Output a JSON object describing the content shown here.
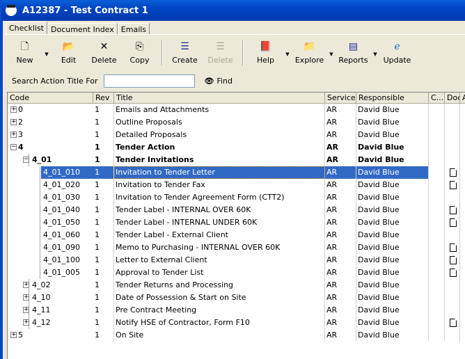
{
  "window": {
    "title": "A12387 - Test Contract 1"
  },
  "tabs": [
    {
      "label": "Checklist",
      "active": true
    },
    {
      "label": "Document Index"
    },
    {
      "label": "Emails"
    }
  ],
  "toolbar": [
    {
      "label": "New",
      "icon": "new-document-icon",
      "dropdown": true
    },
    {
      "label": "Edit",
      "icon": "open-folder-icon"
    },
    {
      "label": "Delete",
      "icon": "delete-x-icon"
    },
    {
      "label": "Copy",
      "icon": "copy-icon"
    },
    {
      "sep": true
    },
    {
      "label": "Create",
      "icon": "create-document-icon"
    },
    {
      "label": "Delete",
      "icon": "delete-document-icon",
      "disabled": true
    },
    {
      "sep": true
    },
    {
      "label": "Help",
      "icon": "help-book-icon",
      "dropdown": true
    },
    {
      "label": "Explore",
      "icon": "explore-folder-icon",
      "dropdown": true
    },
    {
      "label": "Reports",
      "icon": "reports-icon",
      "dropdown": true
    },
    {
      "label": "Update",
      "icon": "internet-explorer-icon"
    }
  ],
  "search": {
    "label": "Search Action Title For",
    "value": "",
    "find_label": "Find"
  },
  "columns": [
    "Code",
    "Rev",
    "Title",
    "Service",
    "Responsible",
    "C...",
    "Doc",
    "A"
  ],
  "rows": [
    {
      "code": "0",
      "rev": "1",
      "title": "Emails and Attachments",
      "service": "AR",
      "responsible": "David Blue",
      "level": 0,
      "expander": "+",
      "doc": false
    },
    {
      "code": "2",
      "rev": "1",
      "title": "Outline Proposals",
      "service": "AR",
      "responsible": "David Blue",
      "level": 0,
      "expander": "+",
      "doc": false
    },
    {
      "code": "3",
      "rev": "1",
      "title": "Detailed Proposals",
      "service": "AR",
      "responsible": "David Blue",
      "level": 0,
      "expander": "+",
      "doc": false
    },
    {
      "code": "4",
      "rev": "1",
      "title": "Tender Action",
      "service": "AR",
      "responsible": "David Blue",
      "level": 0,
      "expander": "-",
      "bold": true,
      "doc": false
    },
    {
      "code": "4_01",
      "rev": "1",
      "title": "Tender Invitations",
      "service": "AR",
      "responsible": "David Blue",
      "level": 1,
      "expander": "-",
      "bold": true,
      "doc": false
    },
    {
      "code": "4_01_010",
      "rev": "1",
      "title": "Invitation to Tender Letter",
      "service": "AR",
      "responsible": "David Blue",
      "level": 2,
      "selected": true,
      "doc": true
    },
    {
      "code": "4_01_020",
      "rev": "1",
      "title": "Invitation to Tender Fax",
      "service": "AR",
      "responsible": "David Blue",
      "level": 2,
      "doc": true
    },
    {
      "code": "4_01_030",
      "rev": "1",
      "title": "Invitation to Tender Agreement Form (CTT2)",
      "service": "AR",
      "responsible": "David Blue",
      "level": 2,
      "doc": false
    },
    {
      "code": "4_01_040",
      "rev": "1",
      "title": "Tender Label - INTERNAL OVER 60K",
      "service": "AR",
      "responsible": "David Blue",
      "level": 2,
      "doc": true
    },
    {
      "code": "4_01_050",
      "rev": "1",
      "title": "Tender Label - INTERNAL UNDER 60K",
      "service": "AR",
      "responsible": "David Blue",
      "level": 2,
      "doc": true
    },
    {
      "code": "4_01_060",
      "rev": "1",
      "title": "Tender Label - External Client",
      "service": "AR",
      "responsible": "David Blue",
      "level": 2,
      "doc": false
    },
    {
      "code": "4_01_090",
      "rev": "1",
      "title": "Memo to Purchasing - INTERNAL OVER 60K",
      "service": "AR",
      "responsible": "David Blue",
      "level": 2,
      "doc": true
    },
    {
      "code": "4_01_100",
      "rev": "1",
      "title": "Letter to External Client",
      "service": "AR",
      "responsible": "David Blue",
      "level": 2,
      "doc": true
    },
    {
      "code": "4_01_005",
      "rev": "1",
      "title": "Approval to Tender List",
      "service": "AR",
      "responsible": "David Blue",
      "level": 2,
      "doc": true
    },
    {
      "code": "4_02",
      "rev": "1",
      "title": "Tender Returns and Processing",
      "service": "AR",
      "responsible": "David Blue",
      "level": 1,
      "expander": "+",
      "doc": false
    },
    {
      "code": "4_10",
      "rev": "1",
      "title": "Date of Possession & Start on Site",
      "service": "AR",
      "responsible": "David Blue",
      "level": 1,
      "expander": "+",
      "doc": false
    },
    {
      "code": "4_11",
      "rev": "1",
      "title": "Pre Contract Meeting",
      "service": "AR",
      "responsible": "David Blue",
      "level": 1,
      "expander": "+",
      "doc": false
    },
    {
      "code": "4_12",
      "rev": "1",
      "title": "Notify HSE of Contractor, Form F10",
      "service": "AR",
      "responsible": "David Blue",
      "level": 1,
      "expander": "+",
      "doc": true
    },
    {
      "code": "5",
      "rev": "1",
      "title": "On Site",
      "service": "AR",
      "responsible": "David Blue",
      "level": 0,
      "expander": "+",
      "doc": false
    }
  ]
}
